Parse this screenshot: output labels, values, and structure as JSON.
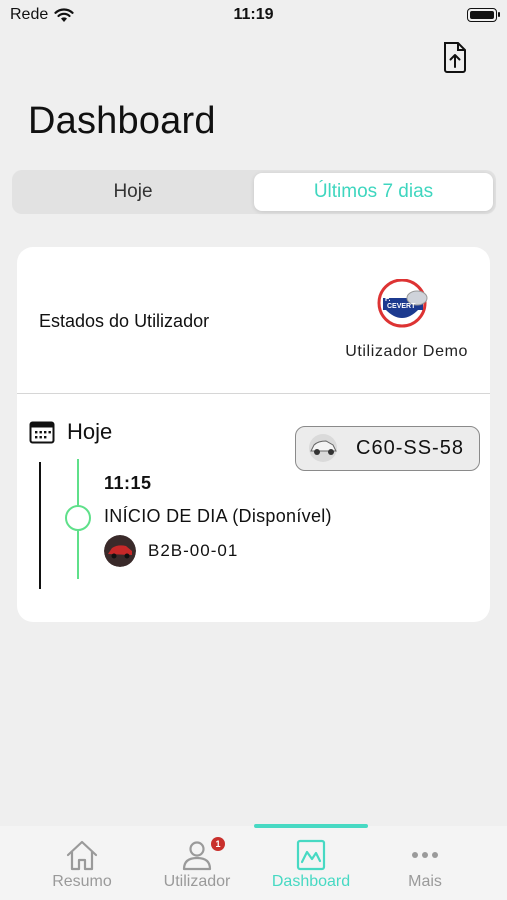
{
  "status_bar": {
    "carrier": "Rede",
    "time": "11:19"
  },
  "header": {
    "title": "Dashboard",
    "export_icon": "document-export-icon"
  },
  "segmented_control": {
    "today_label": "Hoje",
    "week_label": "Últimos 7 dias",
    "selected": "week"
  },
  "user_card": {
    "states_label": "Estados do Utilizador",
    "avatar_logo_text": "F. CEVERT",
    "username": "Utilizador Demo"
  },
  "day": {
    "label": "Hoje",
    "vehicle_plate": "C60-SS-58",
    "events": [
      {
        "time": "11:15",
        "description": "INÍCIO DE DIA (Disponível)",
        "vehicle_plate": "B2B-00-01"
      }
    ]
  },
  "tab_bar": {
    "tabs": [
      {
        "label": "Resumo",
        "icon": "home-icon"
      },
      {
        "label": "Utilizador",
        "icon": "user-icon",
        "badge": "1"
      },
      {
        "label": "Dashboard",
        "icon": "chart-icon"
      },
      {
        "label": "Mais",
        "icon": "more-icon"
      }
    ],
    "active_index": 2
  },
  "colors": {
    "accent": "#47d9c3",
    "timeline": "#5fe08a",
    "badge": "#c9302c"
  }
}
